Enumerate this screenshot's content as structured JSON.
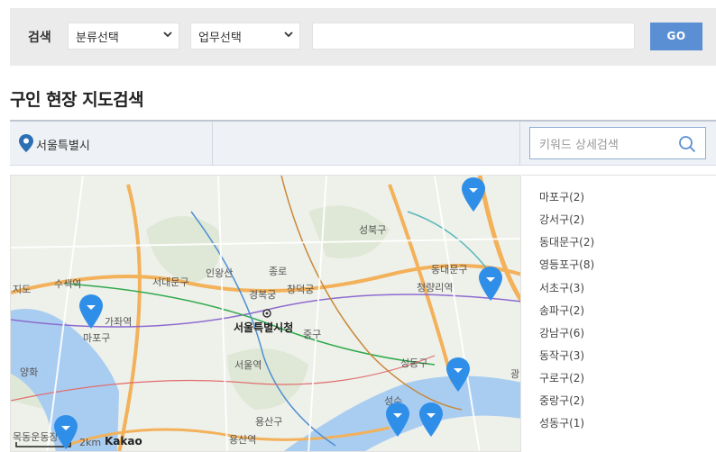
{
  "search": {
    "label": "검색",
    "category_select": "분류선택",
    "job_select": "업무선택",
    "input_value": "",
    "go_label": "GO"
  },
  "page_title": "구인 현장 지도검색",
  "location": {
    "current": "서울특별시",
    "keyword_placeholder": "키워드 상세검색"
  },
  "map": {
    "labels": [
      {
        "text": "성북구",
        "cls": ""
      },
      {
        "text": "인왕산",
        "cls": ""
      },
      {
        "text": "종로",
        "cls": ""
      },
      {
        "text": "서대문구",
        "cls": ""
      },
      {
        "text": "창덕궁",
        "cls": ""
      },
      {
        "text": "경복궁",
        "cls": ""
      },
      {
        "text": "동대문구",
        "cls": ""
      },
      {
        "text": "청량리역",
        "cls": ""
      },
      {
        "text": "지도",
        "cls": ""
      },
      {
        "text": "수색역",
        "cls": ""
      },
      {
        "text": "가좌역",
        "cls": ""
      },
      {
        "text": "마포구",
        "cls": ""
      },
      {
        "text": "서울특별시청",
        "cls": "bold"
      },
      {
        "text": "중구",
        "cls": ""
      },
      {
        "text": "서울역",
        "cls": ""
      },
      {
        "text": "성동구",
        "cls": ""
      },
      {
        "text": "용산구",
        "cls": ""
      },
      {
        "text": "용산역",
        "cls": ""
      },
      {
        "text": "광",
        "cls": ""
      },
      {
        "text": "성수",
        "cls": ""
      },
      {
        "text": "양화",
        "cls": ""
      },
      {
        "text": "목동운동장",
        "cls": ""
      },
      {
        "text": "2km",
        "cls": ""
      },
      {
        "text": "Kakao",
        "cls": "bold"
      }
    ]
  },
  "districts": [
    "마포구(2)",
    "강서구(2)",
    "동대문구(2)",
    "영등포구(8)",
    "서초구(3)",
    "송파구(2)",
    "강남구(6)",
    "동작구(3)",
    "구로구(2)",
    "중랑구(2)",
    "성동구(1)"
  ],
  "colors": {
    "accent": "#5b8fd4",
    "marker": "#2f8fe8",
    "pin": "#2c6fb3"
  }
}
